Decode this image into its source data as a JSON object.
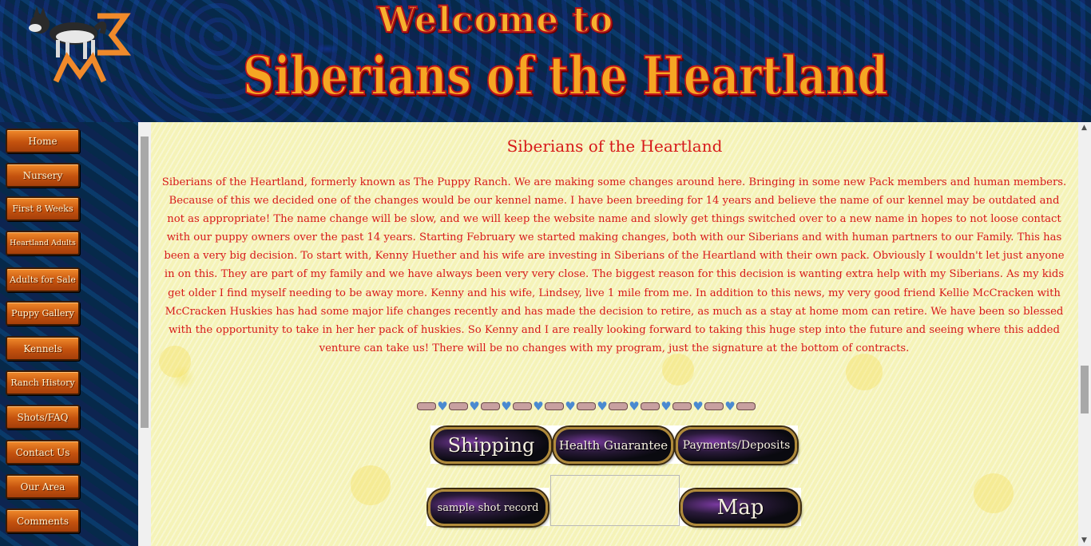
{
  "header": {
    "welcome": "Welcome to",
    "title": "Siberians of the Heartland",
    "logo_alt": "husky-sigma-logo"
  },
  "nav": {
    "items": [
      {
        "label": "Home"
      },
      {
        "label": "Nursery"
      },
      {
        "label": "First 8 Weeks"
      },
      {
        "label": "Heartland Adults"
      },
      {
        "label": "Adults for Sale"
      },
      {
        "label": "Puppy Gallery"
      },
      {
        "label": "Kennels"
      },
      {
        "label": "Ranch History"
      },
      {
        "label": "Shots/FAQ"
      },
      {
        "label": "Contact Us"
      },
      {
        "label": "Our Area"
      },
      {
        "label": "Comments"
      }
    ]
  },
  "main": {
    "heading": "Siberians of the Heartland",
    "intro": "Siberians of the Heartland, formerly known as The Puppy Ranch.  We are making some changes around here.  Bringing in some new Pack members and human members.  Because of this we decided one of the changes would be our kennel name.  I have been breeding for 14 years and believe the name of our kennel may be outdated and not as appropriate!  The name change will be slow, and we will keep the website name and slowly get things switched over to a new name in hopes to not loose contact with our puppy owners over the past 14 years.  Starting February we started making changes, both with our Siberians and with human partners to our Family.  This has been a very big decision.  To start with, Kenny Huether and his wife are investing in Siberians of the Heartland with their own pack.  Obviously I wouldn't let just anyone in on this.  They are part of my family and we have always been very very close.   The biggest reason for this decision is wanting extra help with my Siberians.  As my kids get older I find myself needing to be away more.  Kenny and his wife, Lindsey,  live 1 mile from me.  In addition to this news, my very good friend Kellie McCracken with McCracken Huskies has had some major life changes recently and has made the decision to retire, as much as a stay at home mom can retire.  We have been so blessed with the opportunity to take in her her pack of huskies.  So Kenny and I are really looking forward to taking this huge step into the future and seeing where this added venture can take us!    There will be no changes with my program, just the signature at the bottom of contracts.",
    "buttons_row1": {
      "shipping": "Shipping",
      "health": "Health Guarantee",
      "payments": "Payments/Deposits"
    },
    "buttons_row2": {
      "sample": "sample shot record",
      "map": "Map"
    }
  },
  "colors": {
    "heading_red": "#d71a1a",
    "nav_orange": "#d9651a",
    "title_orange": "#f5a623",
    "content_bg": "#f5f3b8"
  }
}
